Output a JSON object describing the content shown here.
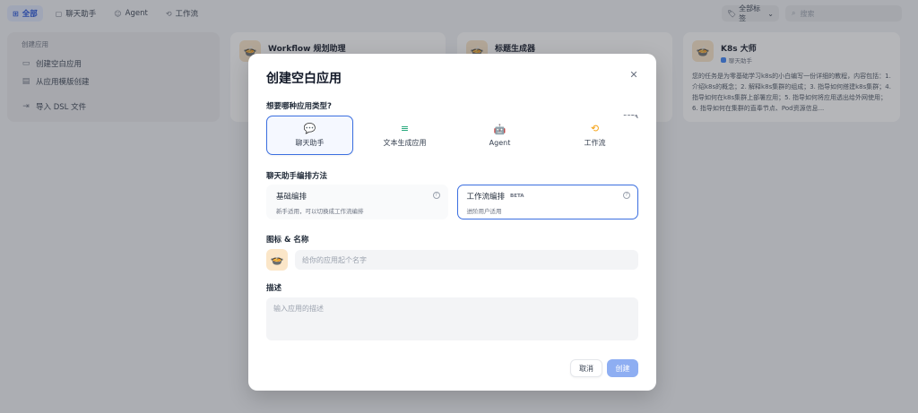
{
  "topbar": {
    "tabs": [
      {
        "label": "全部",
        "icon": "grid-icon",
        "glyph": "⊞",
        "active": true
      },
      {
        "label": "聊天助手",
        "icon": "chat-icon",
        "glyph": "▢",
        "active": false
      },
      {
        "label": "Agent",
        "icon": "agent-icon",
        "glyph": "☺",
        "active": false
      },
      {
        "label": "工作流",
        "icon": "workflow-icon",
        "glyph": "⟲",
        "active": false
      }
    ],
    "tags_label": "全部标签",
    "search_placeholder": "搜索"
  },
  "create_panel": {
    "header": "创建应用",
    "items": [
      {
        "label": "创建空白应用",
        "icon": "file-icon",
        "glyph": "▭"
      },
      {
        "label": "从应用模版创建",
        "icon": "template-icon",
        "glyph": "▤"
      },
      {
        "label": "导入 DSL 文件",
        "icon": "import-icon",
        "glyph": "⇥"
      }
    ]
  },
  "apps": [
    {
      "name": "Workflow 规划助理",
      "type": "",
      "desc": ""
    },
    {
      "name": "标题生成器",
      "type": "",
      "desc": ""
    },
    {
      "name": "K8s 大师",
      "type": "聊天助手",
      "desc": "您的任务是为零基础学习k8s的小白编写一份详细的教程，内容包括：1. 介绍k8s的概念；2. 解释k8s集群的组成；3. 指导如何搭建k8s集群；4. 指导如何在k8s集群上部署应用；5. 指导如何将应用透出给外网使用；6. 指导如何在集群的直奉节点、Pod资源信息..."
    }
  ],
  "modal": {
    "title": "创建空白应用",
    "type_question": "想要哪种应用类型?",
    "beta": "BETA",
    "app_types": [
      {
        "label": "聊天助手",
        "icon": "chat-bubble-icon",
        "glyph": "💬",
        "color": "#2563eb",
        "selected": true
      },
      {
        "label": "文本生成应用",
        "icon": "text-generate-icon",
        "glyph": "≡",
        "color": "#0f9f6e",
        "selected": false
      },
      {
        "label": "Agent",
        "icon": "robot-icon",
        "glyph": "🤖",
        "color": "#6d4fe0",
        "selected": false
      },
      {
        "label": "工作流",
        "icon": "workflow-icon",
        "glyph": "⟲",
        "color": "#f59e0b",
        "selected": false
      }
    ],
    "method_label": "聊天助手编排方法",
    "methods": [
      {
        "title": "基础编排",
        "badge": "",
        "desc": "新手适用，可以切换成工作流编排",
        "selected": false
      },
      {
        "title": "工作流编排",
        "badge": "BETA",
        "desc": "进阶用户适用",
        "selected": true
      }
    ],
    "name_label": "图标 & 名称",
    "name_placeholder": "给你的应用起个名字",
    "desc_label": "描述",
    "desc_placeholder": "输入应用的描述",
    "cancel": "取消",
    "create": "创建"
  }
}
